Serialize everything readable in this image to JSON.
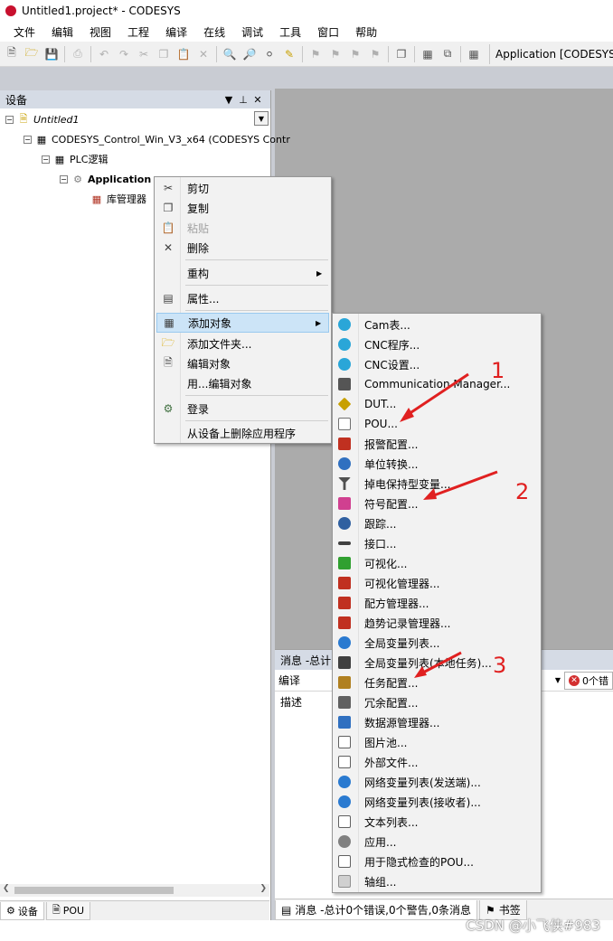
{
  "window": {
    "title": "Untitled1.project* - CODESYS"
  },
  "menubar": [
    "文件",
    "编辑",
    "视图",
    "工程",
    "编译",
    "在线",
    "调试",
    "工具",
    "窗口",
    "帮助"
  ],
  "toolbar": {
    "application_label": "Application [CODESYS"
  },
  "device_panel": {
    "title": "设备",
    "tree": {
      "project": "Untitled1",
      "device": "CODESYS_Control_Win_V3_x64 (CODESYS Contr",
      "plc_logic": "PLC逻辑",
      "application": "Application",
      "library_manager": "库管理器"
    },
    "tabs": [
      "设备",
      "POU"
    ]
  },
  "context_menu": [
    {
      "label": "剪切",
      "icon": "scissors-icon",
      "disabled": false
    },
    {
      "label": "复制",
      "icon": "copy-icon",
      "disabled": false
    },
    {
      "label": "粘贴",
      "icon": "paste-icon",
      "disabled": true
    },
    {
      "label": "删除",
      "icon": "delete-icon",
      "disabled": false
    },
    {
      "label": "重构",
      "icon": "",
      "disabled": false,
      "submenu": true
    },
    {
      "label": "属性...",
      "icon": "properties-icon",
      "disabled": false
    },
    {
      "label": "添加对象",
      "icon": "add-object-icon",
      "disabled": false,
      "submenu": true,
      "highlighted": true
    },
    {
      "label": "添加文件夹...",
      "icon": "folder-icon",
      "disabled": false
    },
    {
      "label": "编辑对象",
      "icon": "edit-object-icon",
      "disabled": false
    },
    {
      "label": "用...编辑对象",
      "icon": "",
      "disabled": false
    },
    {
      "label": "登录",
      "icon": "login-icon",
      "disabled": false
    },
    {
      "label": "从设备上删除应用程序",
      "icon": "",
      "disabled": false
    }
  ],
  "submenu": [
    {
      "label": "Cam表...",
      "icon": "cam-table-icon",
      "color": "#2aa6d8"
    },
    {
      "label": "CNC程序...",
      "icon": "cnc-program-icon",
      "color": "#2aa6d8"
    },
    {
      "label": "CNC设置...",
      "icon": "cnc-settings-icon",
      "color": "#2aa6d8"
    },
    {
      "label": "Communication Manager...",
      "icon": "communication-manager-icon",
      "color": "#555555"
    },
    {
      "label": "DUT...",
      "icon": "dut-icon",
      "color": "#c8a000"
    },
    {
      "label": "POU...",
      "icon": "pou-icon",
      "color": "#707070"
    },
    {
      "label": "报警配置...",
      "icon": "alarm-config-icon",
      "color": "#c03020"
    },
    {
      "label": "单位转换...",
      "icon": "unit-conversion-icon",
      "color": "#3070c0"
    },
    {
      "label": "掉电保持型变量...",
      "icon": "persistent-vars-icon",
      "color": "#505050"
    },
    {
      "label": "符号配置...",
      "icon": "symbol-config-icon",
      "color": "#d04090"
    },
    {
      "label": "跟踪...",
      "icon": "trace-icon",
      "color": "#3060a0"
    },
    {
      "label": "接口...",
      "icon": "interface-icon",
      "color": "#404040"
    },
    {
      "label": "可视化...",
      "icon": "visualization-icon",
      "color": "#30a030"
    },
    {
      "label": "可视化管理器...",
      "icon": "visu-manager-icon",
      "color": "#c03020"
    },
    {
      "label": "配方管理器...",
      "icon": "recipe-manager-icon",
      "color": "#c03020"
    },
    {
      "label": "趋势记录管理器...",
      "icon": "trend-manager-icon",
      "color": "#c03020"
    },
    {
      "label": "全局变量列表...",
      "icon": "global-vars-icon",
      "color": "#2a7ad0"
    },
    {
      "label": "全局变量列表(本地任务)...",
      "icon": "global-vars-local-icon",
      "color": "#404040"
    },
    {
      "label": "任务配置...",
      "icon": "task-config-icon",
      "color": "#b08020"
    },
    {
      "label": "冗余配置...",
      "icon": "redundancy-icon",
      "color": "#606060"
    },
    {
      "label": "数据源管理器...",
      "icon": "datasource-manager-icon",
      "color": "#3070c0"
    },
    {
      "label": "图片池...",
      "icon": "image-pool-icon",
      "color": "#606060"
    },
    {
      "label": "外部文件...",
      "icon": "external-file-icon",
      "color": "#606060"
    },
    {
      "label": "网络变量列表(发送端)...",
      "icon": "network-vars-sender-icon",
      "color": "#2a7ad0"
    },
    {
      "label": "网络变量列表(接收者)...",
      "icon": "network-vars-receiver-icon",
      "color": "#2a7ad0"
    },
    {
      "label": "文本列表...",
      "icon": "text-list-icon",
      "color": "#606060"
    },
    {
      "label": "应用...",
      "icon": "application-icon",
      "color": "#808080"
    },
    {
      "label": "用于隐式检查的POU...",
      "icon": "implicit-check-pou-icon",
      "color": "#606060"
    },
    {
      "label": "轴组...",
      "icon": "axis-group-icon",
      "color": "#909090"
    }
  ],
  "messages_panel": {
    "title": "消息 -总计",
    "filter": "编译",
    "error_badge": "0个错",
    "column": "描述",
    "tab": "消息 -总计0个错误,0个警告,0条消息",
    "bookmarks_tab": "书签"
  },
  "annotations": [
    "1",
    "2",
    "3"
  ],
  "watermark": "CSDN @小飞侠#983"
}
